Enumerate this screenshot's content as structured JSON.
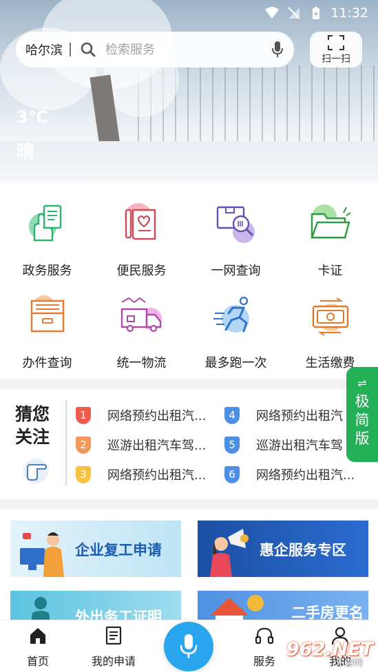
{
  "status_bar": {
    "time": "11:32"
  },
  "search": {
    "city": "哈尔滨",
    "placeholder": "检索服务"
  },
  "scan": {
    "label": "扫一扫"
  },
  "weather": {
    "temperature": "3℃",
    "condition": "晴"
  },
  "services": [
    {
      "label": "政务服务",
      "icon": "document-hand-icon"
    },
    {
      "label": "便民服务",
      "icon": "scroll-pen-icon"
    },
    {
      "label": "一网查询",
      "icon": "search-box-icon"
    },
    {
      "label": "卡证",
      "icon": "folder-icon"
    },
    {
      "label": "办件查询",
      "icon": "drawer-icon"
    },
    {
      "label": "统一物流",
      "icon": "truck-icon"
    },
    {
      "label": "最多跑一次",
      "icon": "runner-icon"
    },
    {
      "label": "生活缴费",
      "icon": "money-exchange-icon"
    }
  ],
  "guess": {
    "title_line1": "猜您",
    "title_line2": "关注",
    "items": [
      {
        "num": "1",
        "text": "网络预约出租汽...",
        "color": "#ef5b4c"
      },
      {
        "num": "2",
        "text": "巡游出租汽车驾...",
        "color": "#f4975b"
      },
      {
        "num": "3",
        "text": "网络预约出租汽...",
        "color": "#f7c243"
      },
      {
        "num": "4",
        "text": "网络预约出租汽",
        "color": "#4b8fe6"
      },
      {
        "num": "5",
        "text": "巡游出租汽车驾",
        "color": "#4b8fe6"
      },
      {
        "num": "6",
        "text": "网络预约出租汽...",
        "color": "#4b8fe6"
      }
    ]
  },
  "simple_mode": {
    "arrows": "⇌",
    "line1": "极",
    "line2": "简",
    "line3": "版"
  },
  "banners": [
    {
      "text": "企业复工申请"
    },
    {
      "text": "惠企服务专区"
    },
    {
      "text": "外出务工证明"
    },
    {
      "text": "二手房更名"
    }
  ],
  "bottom_nav": {
    "home": "首页",
    "my_applications": "我的申请",
    "services": "服务",
    "profile": "我的"
  },
  "watermark": {
    "main": "962.NET",
    "sub": "乐游网"
  },
  "colors": {
    "accent_green": "#23b057",
    "mic_blue": "#2aa6ef"
  }
}
